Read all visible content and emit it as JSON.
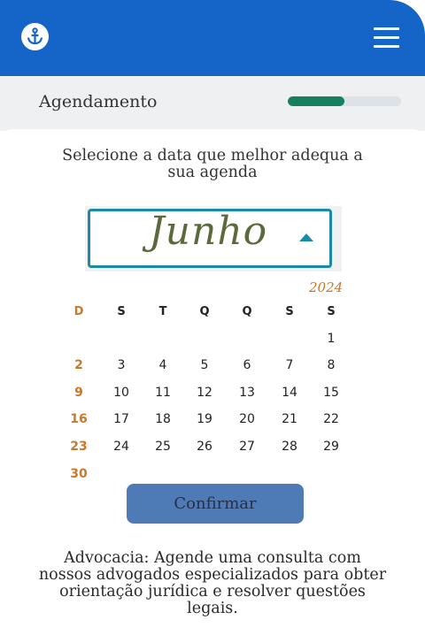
{
  "header": {
    "logo_icon": "anchor-logo-icon",
    "menu_icon": "hamburger-menu-icon",
    "background_color": "#1565c8"
  },
  "step": {
    "title": "Agendamento",
    "progress": 0.5,
    "progress_color": "#14805f"
  },
  "instruction": "Selecione a data que melhor adequa a sua agenda",
  "month_select": {
    "value": "Junho",
    "arrow_icon": "caret-up-icon"
  },
  "calendar": {
    "year": "2024",
    "weekdays": [
      "D",
      "S",
      "T",
      "Q",
      "Q",
      "S",
      "S"
    ],
    "weeks": [
      [
        "",
        "",
        "",
        "",
        "",
        "",
        "1"
      ],
      [
        "2",
        "3",
        "4",
        "5",
        "6",
        "7",
        "8"
      ],
      [
        "9",
        "10",
        "11",
        "12",
        "13",
        "14",
        "15"
      ],
      [
        "16",
        "17",
        "18",
        "19",
        "20",
        "21",
        "22"
      ],
      [
        "23",
        "24",
        "25",
        "26",
        "27",
        "28",
        "29"
      ],
      [
        "30",
        "",
        "",
        "",
        "",
        "",
        ""
      ]
    ],
    "sunday_color": "#c9792a"
  },
  "confirm_label": "Confirmar",
  "footer_text": "Advocacia: Agende uma consulta com nossos advogados especializados para obter orientação jurídica e resolver questões legais."
}
